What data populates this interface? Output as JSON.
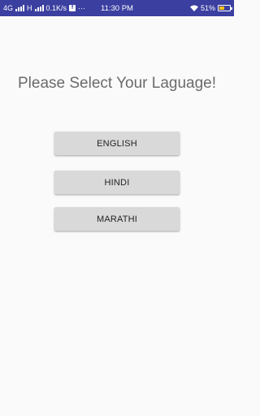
{
  "status_bar": {
    "network": "4G",
    "network2": "H",
    "speed": "0.1K/s",
    "fb_icon": "f",
    "more": "···",
    "time": "11:30 PM",
    "battery": "51%",
    "battery_level": 0.51,
    "icons": [
      "signal-icon",
      "facebook-icon",
      "wifi-icon",
      "battery-icon"
    ],
    "background_color": "#3a3fa0"
  },
  "main": {
    "title": "Please Select Your Laguage!",
    "buttons": [
      {
        "label": "ENGLISH"
      },
      {
        "label": "HINDI"
      },
      {
        "label": "MARATHI"
      }
    ]
  }
}
